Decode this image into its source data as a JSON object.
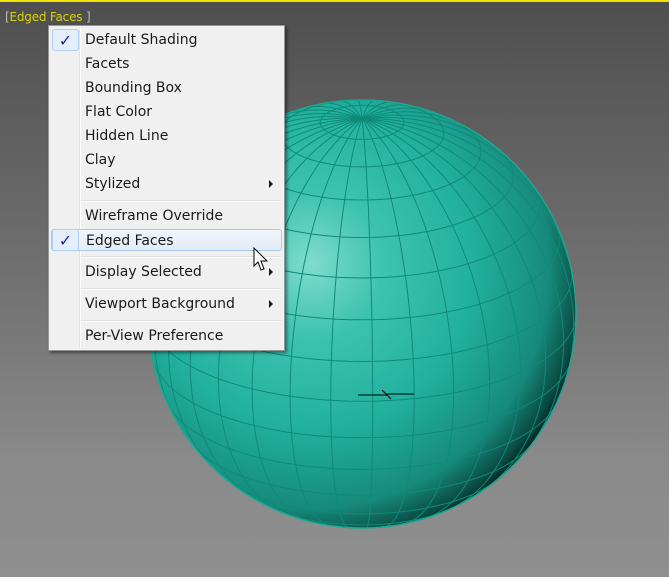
{
  "viewport": {
    "label_open": "[",
    "label": "Edged Faces",
    "label_close": "]",
    "border_color": "#f2e200",
    "object": {
      "type": "sphere",
      "color": "#23b5a2",
      "edge_color": "#0f8a78",
      "shading": "edged-faces"
    }
  },
  "menu": {
    "groups": [
      [
        {
          "label": "Default Shading",
          "checked": true,
          "submenu": false
        },
        {
          "label": "Facets",
          "checked": false,
          "submenu": false
        },
        {
          "label": "Bounding Box",
          "checked": false,
          "submenu": false
        },
        {
          "label": "Flat Color",
          "checked": false,
          "submenu": false
        },
        {
          "label": "Hidden Line",
          "checked": false,
          "submenu": false
        },
        {
          "label": "Clay",
          "checked": false,
          "submenu": false
        },
        {
          "label": "Stylized",
          "checked": false,
          "submenu": true
        }
      ],
      [
        {
          "label": "Wireframe Override",
          "checked": false,
          "submenu": false
        },
        {
          "label": "Edged Faces",
          "checked": true,
          "submenu": false,
          "highlighted": true
        }
      ],
      [
        {
          "label": "Display Selected",
          "checked": false,
          "submenu": true
        }
      ],
      [
        {
          "label": "Viewport Background",
          "checked": false,
          "submenu": true
        }
      ],
      [
        {
          "label": "Per-View Preference",
          "checked": false,
          "submenu": false
        }
      ]
    ],
    "check_glyph": "✓"
  }
}
